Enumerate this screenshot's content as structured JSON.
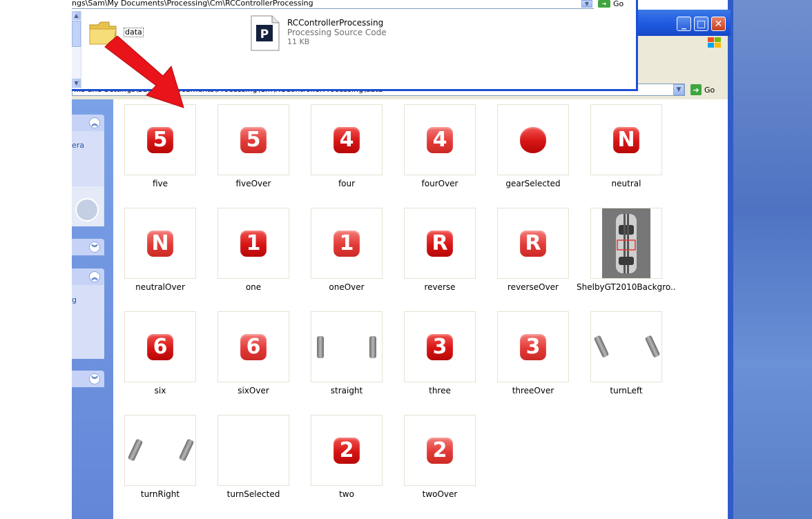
{
  "front_window": {
    "address": "ngs\\Sam\\My Documents\\Processing\\Cm\\RCControllerProcessing",
    "go_label": "Go",
    "folder_name": "data",
    "file": {
      "name": "RCControllerProcessing",
      "type": "Processing Source Code",
      "size": "11 KB"
    },
    "file_icon_letter": "P"
  },
  "back_window": {
    "address": "...s and Settings\\Sam\\My Documents\\Processing\\Cm\\RCControllerProcessing\\data",
    "go_label": "Go",
    "task_pane": {
      "text_1": "era",
      "text_2": "g"
    }
  },
  "files": [
    {
      "label": "five",
      "glyph": "5",
      "over": false
    },
    {
      "label": "fiveOver",
      "glyph": "5",
      "over": true
    },
    {
      "label": "four",
      "glyph": "4",
      "over": false
    },
    {
      "label": "fourOver",
      "glyph": "4",
      "over": true
    },
    {
      "label": "gearSelected",
      "glyph": "",
      "over": false
    },
    {
      "label": "neutral",
      "glyph": "N",
      "over": false
    },
    {
      "label": "neutralOver",
      "glyph": "N",
      "over": true
    },
    {
      "label": "one",
      "glyph": "1",
      "over": false
    },
    {
      "label": "oneOver",
      "glyph": "1",
      "over": true
    },
    {
      "label": "reverse",
      "glyph": "R",
      "over": false
    },
    {
      "label": "reverseOver",
      "glyph": "R",
      "over": true
    },
    {
      "label": "ShelbyGT2010Backgro...",
      "glyph": "",
      "over": false
    },
    {
      "label": "six",
      "glyph": "6",
      "over": false
    },
    {
      "label": "sixOver",
      "glyph": "6",
      "over": true
    },
    {
      "label": "straight",
      "glyph": "",
      "over": false
    },
    {
      "label": "three",
      "glyph": "3",
      "over": false
    },
    {
      "label": "threeOver",
      "glyph": "3",
      "over": true
    },
    {
      "label": "turnLeft",
      "glyph": "",
      "over": false
    },
    {
      "label": "turnRight",
      "glyph": "",
      "over": false
    },
    {
      "label": "turnSelected",
      "glyph": "",
      "over": false
    },
    {
      "label": "two",
      "glyph": "2",
      "over": false
    },
    {
      "label": "twoOver",
      "glyph": "2",
      "over": true
    }
  ],
  "colors": {
    "xp_blue": "#1e5ae0",
    "gear_red": "#d61414",
    "pointer_arrow": "#e8141a"
  }
}
